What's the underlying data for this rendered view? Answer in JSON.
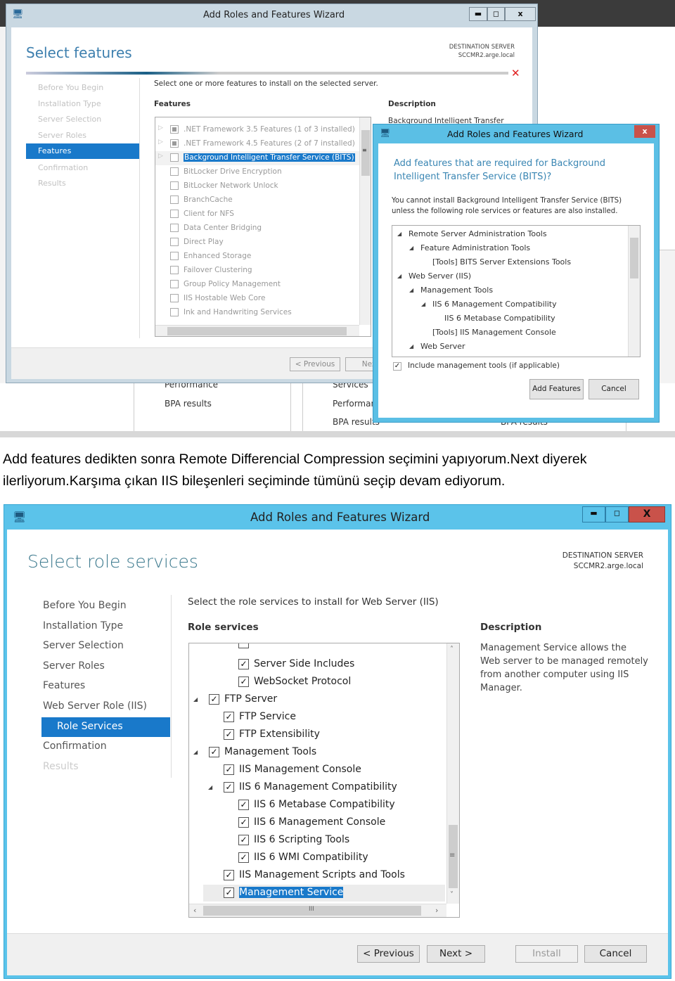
{
  "screenshot1": {
    "window_title": "Add Roles and Features Wizard",
    "controls": {
      "minimize": "▬",
      "maximize": "◻",
      "close": "x"
    },
    "page_title": "Select features",
    "destination_label": "DESTINATION SERVER",
    "destination_server": "SCCMR2.arge.local",
    "error_icon": "red-x-icon",
    "sidebar": [
      "Before You Begin",
      "Installation Type",
      "Server Selection",
      "Server Roles",
      "Features",
      "Confirmation",
      "Results"
    ],
    "sidebar_selected": "Features",
    "instruction": "Select one or more features to install on the selected server.",
    "features_heading": "Features",
    "description_heading": "Description",
    "description_text": "Background Intelligent Transfer",
    "features": [
      {
        "label": ".NET Framework 3.5 Features (1 of 3 installed)",
        "state": "partial",
        "expandable": true
      },
      {
        "label": ".NET Framework 4.5 Features (2 of 7 installed)",
        "state": "partial",
        "expandable": true
      },
      {
        "label": "Background Intelligent Transfer Service (BITS)",
        "state": "unchecked",
        "expandable": true,
        "selected": true
      },
      {
        "label": "BitLocker Drive Encryption",
        "state": "unchecked"
      },
      {
        "label": "BitLocker Network Unlock",
        "state": "unchecked"
      },
      {
        "label": "BranchCache",
        "state": "unchecked"
      },
      {
        "label": "Client for NFS",
        "state": "unchecked"
      },
      {
        "label": "Data Center Bridging",
        "state": "unchecked"
      },
      {
        "label": "Direct Play",
        "state": "unchecked"
      },
      {
        "label": "Enhanced Storage",
        "state": "unchecked"
      },
      {
        "label": "Failover Clustering",
        "state": "unchecked"
      },
      {
        "label": "Group Policy Management",
        "state": "unchecked"
      },
      {
        "label": "IIS Hostable Web Core",
        "state": "unchecked"
      },
      {
        "label": "Ink and Handwriting Services",
        "state": "unchecked"
      }
    ],
    "previous_button": "< Previous",
    "next_button": "Next",
    "background_text": [
      "Performance",
      "BPA results",
      "Services",
      "Performance",
      "BPA results",
      "BPA results"
    ],
    "dialog": {
      "title": "Add Roles and Features Wizard",
      "close": "x",
      "heading_line1": "Add features that are required for Background",
      "heading_line2": "Intelligent Transfer Service (BITS)?",
      "body_line1": "You cannot install Background Intelligent Transfer Service (BITS)",
      "body_line2": "unless the following role services or features are also installed.",
      "tree": [
        {
          "label": "Remote Server Administration Tools",
          "level": 0,
          "expander": true
        },
        {
          "label": "Feature Administration Tools",
          "level": 1,
          "expander": true
        },
        {
          "label": "[Tools] BITS Server Extensions Tools",
          "level": 2
        },
        {
          "label": "Web Server (IIS)",
          "level": 0,
          "expander": true
        },
        {
          "label": "Management Tools",
          "level": 1,
          "expander": true
        },
        {
          "label": "IIS 6 Management Compatibility",
          "level": 2,
          "expander": true
        },
        {
          "label": "IIS 6 Metabase Compatibility",
          "level": 3
        },
        {
          "label": "[Tools] IIS Management Console",
          "level": 2
        },
        {
          "label": "Web Server",
          "level": 1,
          "expander": true
        }
      ],
      "include_tools_label": "Include management tools (if applicable)",
      "include_tools_checked": true,
      "add_features_button": "Add Features",
      "cancel_button": "Cancel"
    }
  },
  "caption": {
    "line1": "Add features dedikten sonra Remote Differencial Compression seçimini yapıyorum.Next diyerek",
    "line2": "ilerliyorum.Karşıma çıkan IIS bileşenleri seçiminde tümünü seçip devam ediyorum."
  },
  "screenshot2": {
    "window_title": "Add Roles and Features Wizard",
    "controls": {
      "minimize": "▬",
      "maximize": "◻",
      "close": "X"
    },
    "page_title": "Select role services",
    "destination_label": "DESTINATION SERVER",
    "destination_server": "SCCMR2.arge.local",
    "sidebar": [
      "Before You Begin",
      "Installation Type",
      "Server Selection",
      "Server Roles",
      "Features",
      "Web Server Role (IIS)",
      "Role Services",
      "Confirmation",
      "Results"
    ],
    "sidebar_selected": "Role Services",
    "instruction": "Select the role services to install for Web Server (IIS)",
    "role_services_heading": "Role services",
    "description_heading": "Description",
    "description_lines": [
      "Management Service allows the",
      "Web server to be managed remotely",
      "from another computer using IIS",
      "Manager."
    ],
    "role_services": [
      {
        "label": "Server Side Includes",
        "level": 2,
        "checked": true
      },
      {
        "label": "WebSocket Protocol",
        "level": 2,
        "checked": true
      },
      {
        "label": "FTP Server",
        "level": 0,
        "checked": true,
        "expander": true
      },
      {
        "label": "FTP Service",
        "level": 1,
        "checked": true
      },
      {
        "label": "FTP Extensibility",
        "level": 1,
        "checked": true
      },
      {
        "label": "Management Tools",
        "level": 0,
        "checked": true,
        "expander": true
      },
      {
        "label": "IIS Management Console",
        "level": 1,
        "checked": true
      },
      {
        "label": "IIS 6 Management Compatibility",
        "level": 1,
        "checked": true,
        "expander": true
      },
      {
        "label": "IIS 6 Metabase Compatibility",
        "level": 2,
        "checked": true
      },
      {
        "label": "IIS 6 Management Console",
        "level": 2,
        "checked": true
      },
      {
        "label": "IIS 6 Scripting Tools",
        "level": 2,
        "checked": true
      },
      {
        "label": "IIS 6 WMI Compatibility",
        "level": 2,
        "checked": true
      },
      {
        "label": "IIS Management Scripts and Tools",
        "level": 1,
        "checked": true
      },
      {
        "label": "Management Service",
        "level": 1,
        "checked": true,
        "selected": true
      }
    ],
    "previous_button": "< Previous",
    "next_button": "Next >",
    "install_button": "Install",
    "cancel_button": "Cancel"
  }
}
